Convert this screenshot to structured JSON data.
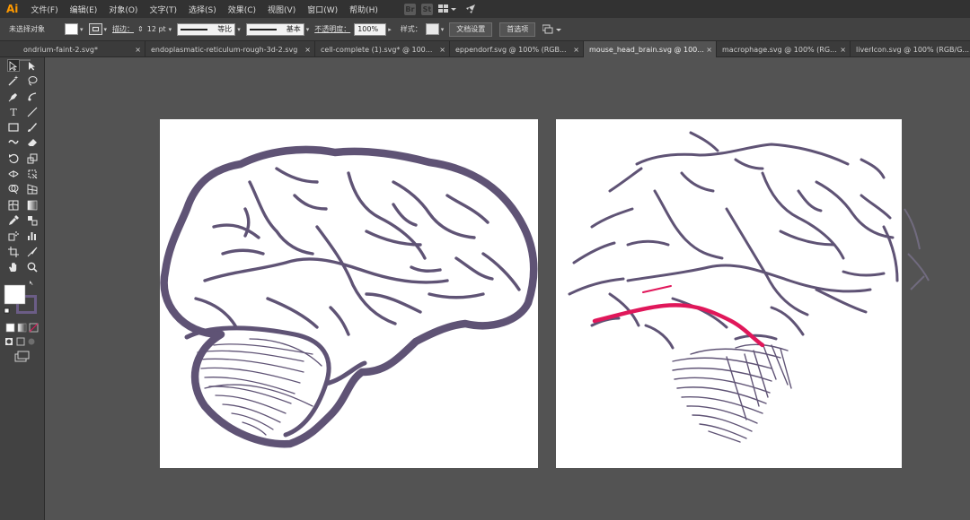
{
  "app": {
    "logo": "Ai"
  },
  "menu": [
    "文件(F)",
    "编辑(E)",
    "对象(O)",
    "文字(T)",
    "选择(S)",
    "效果(C)",
    "视图(V)",
    "窗口(W)",
    "帮助(H)"
  ],
  "menu_right": {
    "br_label": "Br",
    "st_label": "St"
  },
  "control_bar": {
    "selection_status": "未选择对象",
    "stroke_label": "描边：",
    "stroke_weight": "12 pt",
    "profile_label": "等比",
    "brush_label": "基本",
    "opacity_label": "不透明度：",
    "opacity_value": "100%",
    "style_label": "样式：",
    "doc_setup_button": "文档设置",
    "preferences_button": "首选项"
  },
  "tabs": [
    "ondrium-faint-2.svg*",
    "endoplasmatic-reticulum-rough-3d-2.svg",
    "cell-complete (1).svg* @ 100...",
    "eppendorf.svg @ 100% (RGB...",
    "mouse_head_brain.svg @ 100...",
    "macrophage.svg @ 100% (RG...",
    "liverIcon.svg @ 100% (RGB/G..."
  ],
  "colors": {
    "brain_outline": "#5f5375",
    "highlight_path": "#e0175a",
    "artboard": "#ffffff",
    "canvas": "#535353",
    "menubar": "#323232",
    "panel": "#424242",
    "logo": "#ff9a00"
  }
}
